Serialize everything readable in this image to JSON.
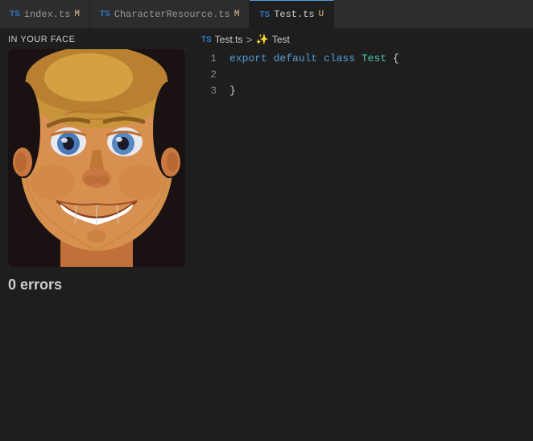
{
  "tabBar": {
    "tabs": [
      {
        "id": "index",
        "icon": "TS",
        "label": "index.ts",
        "modified": "M",
        "active": false
      },
      {
        "id": "charresource",
        "icon": "TS",
        "label": "CharacterResource.ts",
        "modified": "M",
        "active": false
      },
      {
        "id": "test",
        "icon": "TS",
        "label": "Test.ts",
        "modified": "U",
        "active": true
      }
    ]
  },
  "leftPanel": {
    "title": "IN YOUR FACE",
    "errorCount": "0 errors"
  },
  "breadcrumb": {
    "fileIcon": "TS",
    "fileName": "Test.ts",
    "separator": ">",
    "classIcon": "꩜",
    "className": "Test"
  },
  "codeLines": [
    {
      "number": "1",
      "tokens": [
        {
          "text": "export ",
          "class": "kw-export"
        },
        {
          "text": "default ",
          "class": "kw-default"
        },
        {
          "text": "class ",
          "class": "kw-class"
        },
        {
          "text": "Test ",
          "class": "class-name"
        },
        {
          "text": "{",
          "class": "punctuation"
        }
      ]
    },
    {
      "number": "2",
      "tokens": []
    },
    {
      "number": "3",
      "tokens": [
        {
          "text": "}",
          "class": "punctuation"
        }
      ]
    }
  ],
  "colors": {
    "background": "#1e1e1e",
    "tabBg": "#2d2d2d",
    "activeBorder": "#569cd6",
    "tsBlue": "#3178c6"
  }
}
